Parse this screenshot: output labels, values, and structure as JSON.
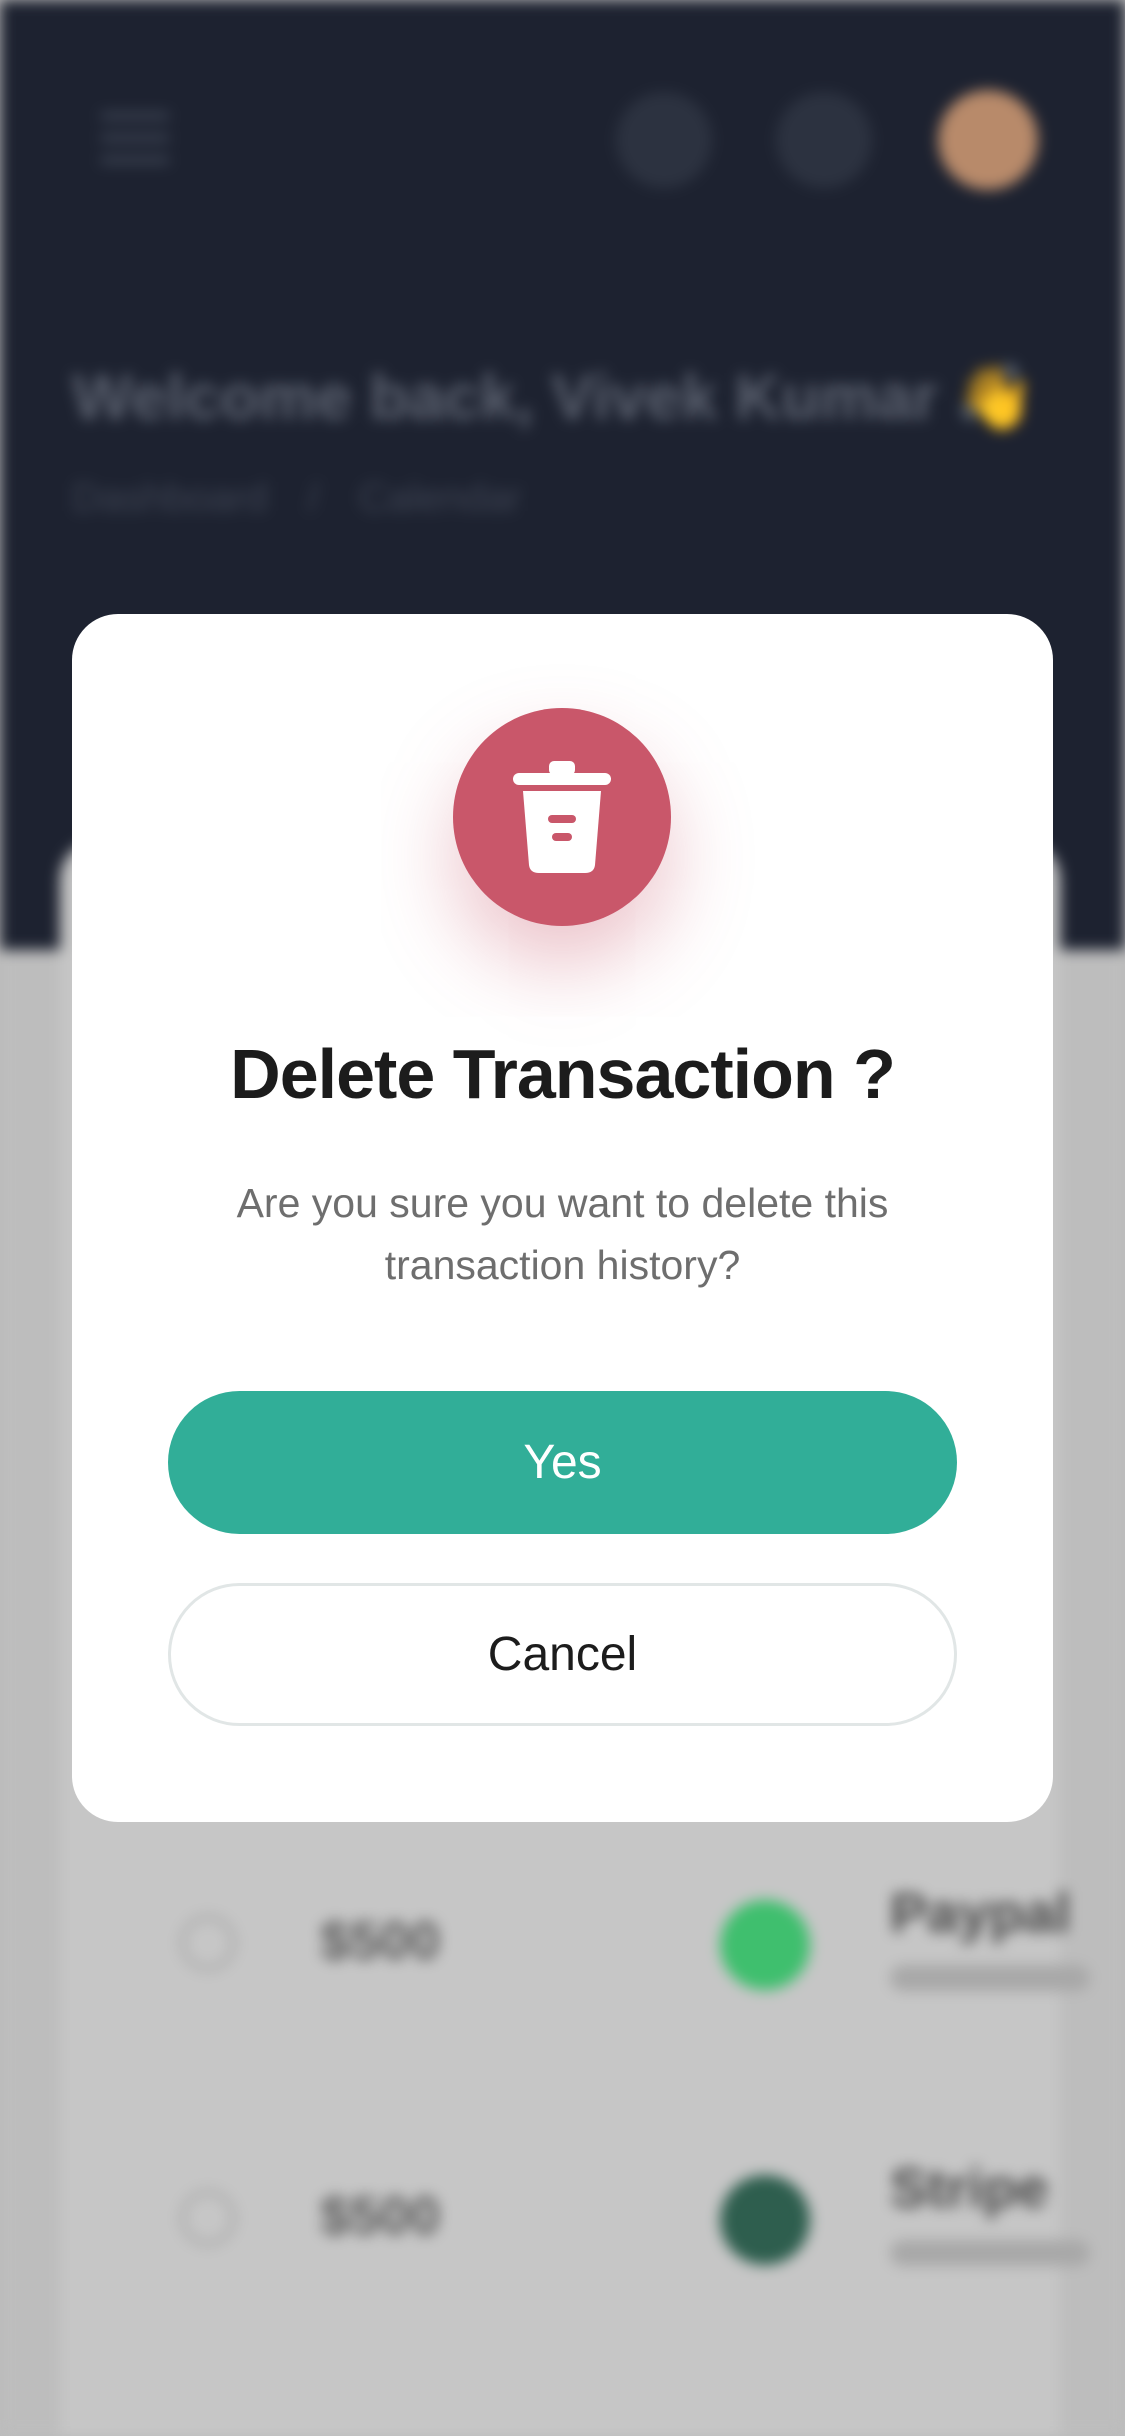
{
  "background": {
    "header": {
      "welcome": "Welcome back, Vivek Kumar 👋",
      "breadcrumb_home": "Dashboard",
      "breadcrumb_sep": "/",
      "breadcrumb_current": "Calendar"
    },
    "rows": [
      {
        "amount": "$500",
        "name": "Paypal",
        "dot_color": "#3fbf6e"
      },
      {
        "amount": "$500",
        "name": "Stripe",
        "dot_color": "#2e5e4e"
      }
    ]
  },
  "modal": {
    "icon": "trash-icon",
    "title": "Delete Transaction ?",
    "description": "Are you sure you want to delete this transaction history?",
    "yes_label": "Yes",
    "cancel_label": "Cancel",
    "colors": {
      "danger": "#c9576a",
      "primary": "#31ae98"
    }
  }
}
